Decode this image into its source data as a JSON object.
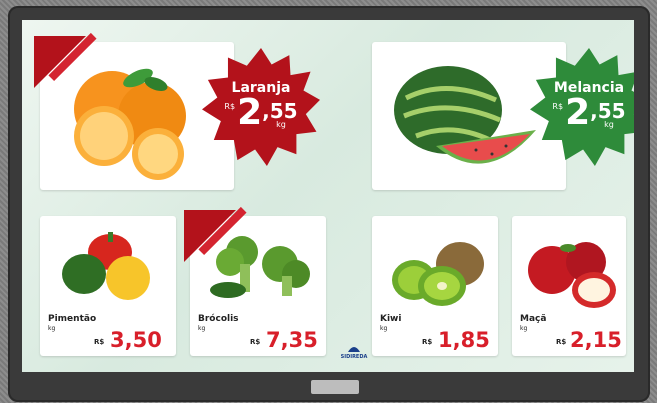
{
  "featured": [
    {
      "name": "Laranja",
      "currency": "R$",
      "price_int": "2",
      "price_dec": ",55",
      "unit": "kg",
      "badge_color": "#b3121b"
    },
    {
      "name": "Melancia",
      "currency": "R$",
      "price_int": "2",
      "price_dec": ",55",
      "unit": "kg",
      "badge_color": "#2e8b3a"
    }
  ],
  "products": [
    {
      "name": "Pimentão",
      "unit": "kg",
      "currency": "R$",
      "price": "3,50"
    },
    {
      "name": "Brócolis",
      "unit": "kg",
      "currency": "R$",
      "price": "7,35"
    },
    {
      "name": "Kiwi",
      "unit": "kg",
      "currency": "R$",
      "price": "1,85"
    },
    {
      "name": "Maçã",
      "unit": "kg",
      "currency": "R$",
      "price": "2,15"
    }
  ],
  "logo": {
    "text": "SIDIREDA"
  },
  "colors": {
    "price_red": "#d81f2a",
    "ribbon_red": "#b3121b",
    "badge_green": "#2e8b3a"
  }
}
